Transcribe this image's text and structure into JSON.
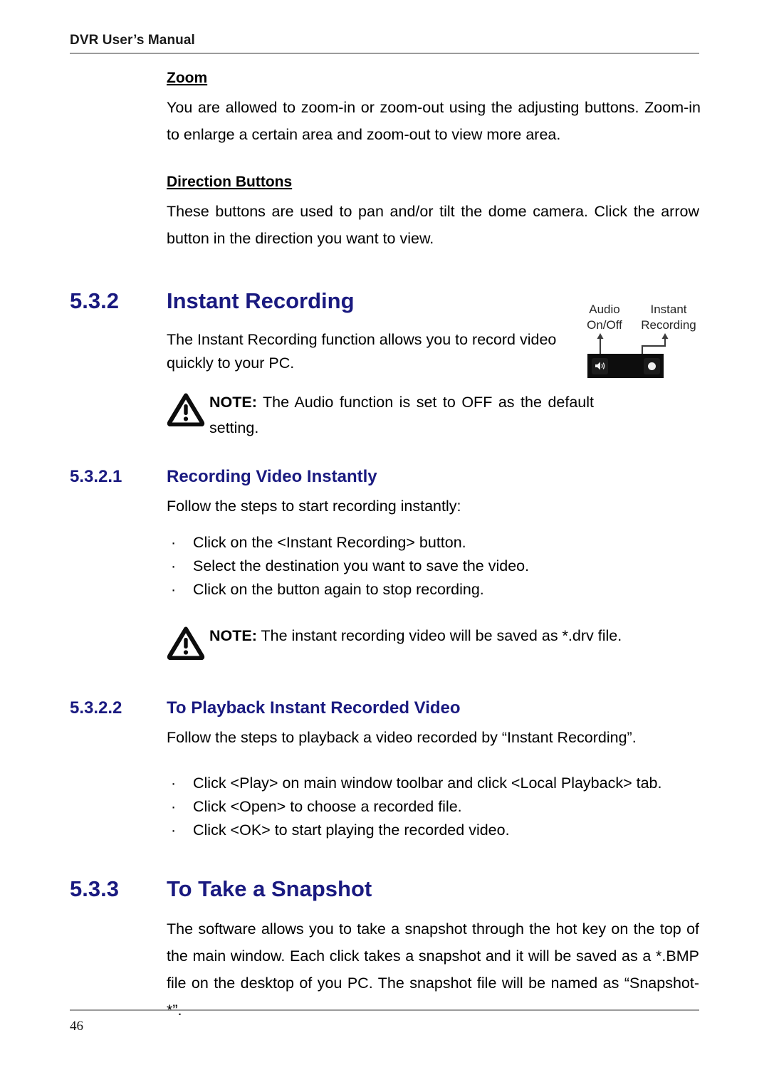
{
  "header": {
    "title": "DVR User’s Manual"
  },
  "footer": {
    "page_number": "46"
  },
  "sections": {
    "zoom": {
      "heading": "Zoom",
      "paragraph": "You are allowed to zoom-in or zoom-out using the adjusting buttons. Zoom-in to enlarge a certain area and zoom-out to view more area."
    },
    "direction_buttons": {
      "heading": "Direction Buttons",
      "paragraph": "These buttons are used to pan and/or tilt the dome camera. Click the arrow button in the direction you want to view."
    },
    "instant_recording": {
      "number": "5.3.2",
      "title": "Instant Recording",
      "paragraph": "The Instant Recording function allows you to record video quickly to your PC.",
      "note": {
        "label": "NOTE:",
        "text": " The Audio function is set to OFF as the default setting."
      }
    },
    "recording_video_instantly": {
      "number": "5.3.2.1",
      "title": "Recording Video Instantly",
      "intro": "Follow the steps to start recording instantly:",
      "bullet_marker": "·",
      "bullets": [
        "Click on the <Instant Recording> button.",
        "Select the destination you want to save the video.",
        "Click on the button again to stop recording."
      ],
      "note": {
        "label": "NOTE:",
        "text": " The instant recording video will be saved as *.drv file."
      }
    },
    "playback_instant_recorded_video": {
      "number": "5.3.2.2",
      "title": "To Playback Instant Recorded Video",
      "intro": "Follow the steps to playback a video recorded by “Instant Recording”.",
      "bullet_marker": "·",
      "bullets": [
        "Click <Play> on main window toolbar and click <Local Playback> tab.",
        "Click <Open> to choose a recorded file.",
        "Click <OK> to start playing the recorded video."
      ]
    },
    "take_a_snapshot": {
      "number": "5.3.3",
      "title": "To Take a Snapshot",
      "paragraph": "The software allows you to take a snapshot through the hot key on the top of the main window. Each click takes a snapshot and it will be saved as a *.BMP file on the desktop of you PC. The snapshot file will be named as “Snapshot-*”."
    }
  },
  "figure": {
    "label_audio_line1": "Audio",
    "label_audio_line2": "On/Off",
    "label_instant_line1": "Instant",
    "label_instant_line2": "Recording"
  },
  "colors": {
    "heading_blue": "#1a1a80",
    "rule_gray": "#9b9b9b",
    "text_black": "#000000"
  }
}
